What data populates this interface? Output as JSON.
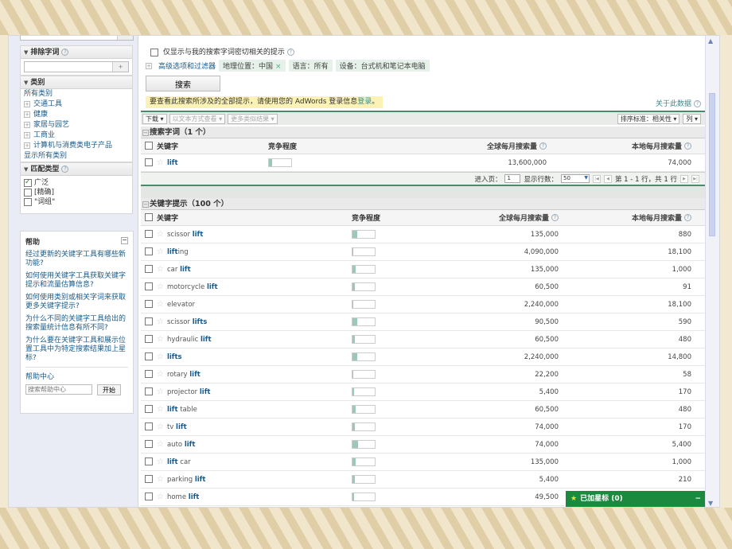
{
  "sidebar": {
    "exclude_title": "排除字词",
    "exclude_input": "",
    "category_title": "类别",
    "all_categories": "所有类别",
    "categories": [
      "交通工具",
      "健康",
      "家居与园艺",
      "工商业",
      "计算机与消费类电子产品"
    ],
    "show_all": "显示所有类别",
    "match_title": "匹配类型",
    "match_types": [
      {
        "label": "广泛",
        "checked": true
      },
      {
        "label": "[精确]",
        "checked": false
      },
      {
        "label": "\"词组\"",
        "checked": false
      }
    ],
    "help": {
      "title": "帮助",
      "questions": [
        "经过更新的关键字工具有哪些新功能?",
        "如何使用关键字工具获取关键字提示和流量估算信息?",
        "如何使用类别或相关字词来获取更多关键字提示?",
        "为什么不同的关键字工具给出的搜索量统计信息有所不同?",
        "为什么要在关键字工具和展示位置工具中为特定搜索结果加上星标?"
      ],
      "center_label": "帮助中心",
      "search_placeholder": "搜索帮助中心",
      "go_label": "开始"
    }
  },
  "main": {
    "only_related_label": "仅显示与我的搜索字词密切相关的提示",
    "advanced_label": "高级选项和过滤器",
    "filters": {
      "location": "地理位置：中国",
      "language": "语言：所有",
      "device": "设备：台式机和笔记本电脑"
    },
    "search_button": "搜索",
    "notice_text": "要查看此搜索所涉及的全部提示，请使用您的 AdWords 登录信息",
    "notice_link": "登录",
    "notice_end": "。",
    "about_data": "关于此数据",
    "toolbar": {
      "download": "下载",
      "view_as_text": "以文本方式查看",
      "more_like": "更多类似结果",
      "sort": "排序标准：相关性",
      "columns": "列"
    },
    "columns": {
      "keyword": "关键字",
      "competition": "竞争程度",
      "global": "全球每月搜索量",
      "local": "本地每月搜索量"
    },
    "search_terms": {
      "title": "搜索字词（1 个）",
      "rows": [
        {
          "prefix": "",
          "bold": "lift",
          "suffix": "",
          "competition": 0.13,
          "global": "13,600,000",
          "local": "74,000"
        }
      ]
    },
    "pager": {
      "goto_label": "进入页：",
      "page": "1",
      "rows_label": "显示行数：",
      "rows_value": "50",
      "range": "第 1 - 1 行，共 1 行"
    },
    "ideas": {
      "title": "关键字提示（100 个）",
      "rows": [
        {
          "prefix": "scissor ",
          "bold": "lift",
          "suffix": "",
          "competition": 0.2,
          "global": "135,000",
          "local": "880"
        },
        {
          "prefix": "",
          "bold": "lift",
          "suffix": "ing",
          "competition": 0.04,
          "global": "4,090,000",
          "local": "18,100"
        },
        {
          "prefix": "car ",
          "bold": "lift",
          "suffix": "",
          "competition": 0.15,
          "global": "135,000",
          "local": "1,000"
        },
        {
          "prefix": "motorcycle ",
          "bold": "lift",
          "suffix": "",
          "competition": 0.12,
          "global": "60,500",
          "local": "91"
        },
        {
          "prefix": "elevator",
          "bold": "",
          "suffix": "",
          "competition": 0.04,
          "global": "2,240,000",
          "local": "18,100"
        },
        {
          "prefix": "scissor ",
          "bold": "lifts",
          "suffix": "",
          "competition": 0.22,
          "global": "90,500",
          "local": "590"
        },
        {
          "prefix": "hydraulic ",
          "bold": "lift",
          "suffix": "",
          "competition": 0.12,
          "global": "60,500",
          "local": "480"
        },
        {
          "prefix": "",
          "bold": "lifts",
          "suffix": "",
          "competition": 0.2,
          "global": "2,240,000",
          "local": "14,800"
        },
        {
          "prefix": "rotary ",
          "bold": "lift",
          "suffix": "",
          "competition": 0.03,
          "global": "22,200",
          "local": "58"
        },
        {
          "prefix": "projector ",
          "bold": "lift",
          "suffix": "",
          "competition": 0.06,
          "global": "5,400",
          "local": "170"
        },
        {
          "prefix": "",
          "bold": "lift",
          "suffix": " table",
          "competition": 0.14,
          "global": "60,500",
          "local": "480"
        },
        {
          "prefix": "tv ",
          "bold": "lift",
          "suffix": "",
          "competition": 0.1,
          "global": "74,000",
          "local": "170"
        },
        {
          "prefix": "auto ",
          "bold": "lift",
          "suffix": "",
          "competition": 0.25,
          "global": "74,000",
          "local": "5,400"
        },
        {
          "prefix": "",
          "bold": "lift",
          "suffix": " car",
          "competition": 0.16,
          "global": "135,000",
          "local": "1,000"
        },
        {
          "prefix": "parking ",
          "bold": "lift",
          "suffix": "",
          "competition": 0.12,
          "global": "5,400",
          "local": "210"
        },
        {
          "prefix": "home ",
          "bold": "lift",
          "suffix": "",
          "competition": 0.08,
          "global": "49,500",
          "local": ""
        }
      ]
    },
    "starred_panel": {
      "label": "已加星标 (0)"
    }
  }
}
